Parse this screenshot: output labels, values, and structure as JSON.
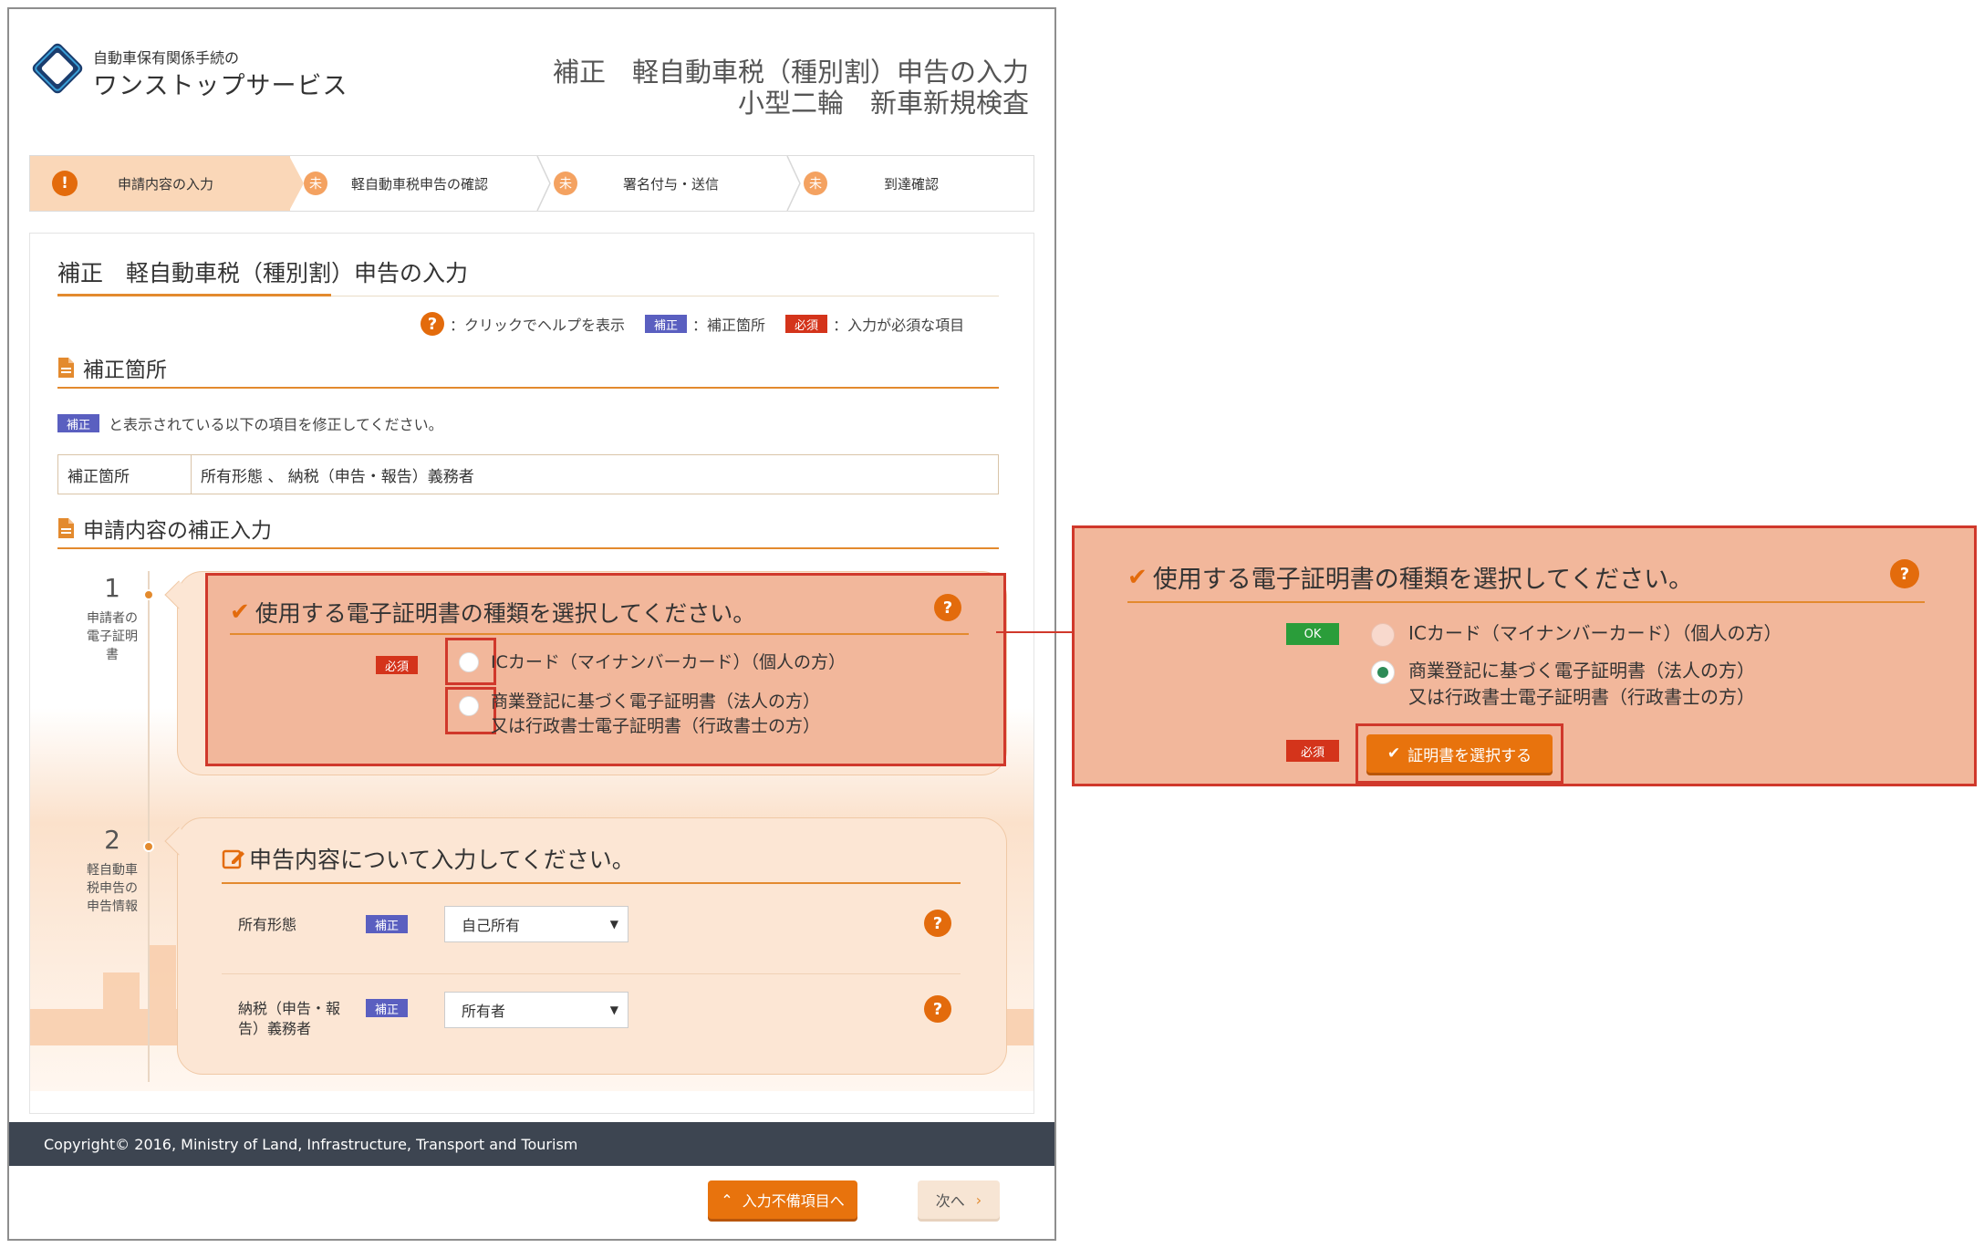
{
  "colors": {
    "accent": "#e8730d",
    "highlight": "#d0382b",
    "card_bg": "#fce6d4",
    "footer_bg": "#3d4551",
    "badge_fix": "#5a5fc0",
    "badge_required": "#d4341b",
    "badge_ok": "#2a9d3a"
  },
  "header": {
    "logo_small": "自動車保有関係手続の",
    "logo_big": "ワンストップサービス",
    "title_line1": "補正　軽自動車税（種別割）申告の入力",
    "title_line2": "小型二輪　新車新規検査"
  },
  "steps": [
    {
      "icon": "!",
      "label": "申請内容の入力"
    },
    {
      "icon": "未",
      "label": "軽自動車税申告の確認"
    },
    {
      "icon": "未",
      "label": "署名付与・送信"
    },
    {
      "icon": "未",
      "label": "到達確認"
    }
  ],
  "page": {
    "heading": "補正　軽自動車税（種別割）申告の入力",
    "legend": {
      "help_icon": "?",
      "help_text": "：クリックでヘルプを表示",
      "fix_badge": "補正",
      "fix_text": "：補正箇所",
      "required_badge": "必須",
      "required_text": "：入力が必須な項目"
    },
    "section1_title": "補正箇所",
    "notice_badge": "補正",
    "notice_text": "と表示されている以下の項目を修正してください。",
    "fix_key": "補正箇所",
    "fix_value": "所有形態 、 納税（申告・報告）義務者",
    "section2_title": "申請内容の補正入力"
  },
  "timeline": [
    {
      "number": "1",
      "label": "申請者の電子証明書"
    },
    {
      "number": "2",
      "label": "軽自動車税申告の申告情報"
    }
  ],
  "card1": {
    "title": "使用する電子証明書の種類を選択してください。",
    "required_badge": "必須",
    "option1": "ICカード（マイナンバーカード）（個人の方）",
    "option2_line1": "商業登記に基づく電子証明書（法人の方）",
    "option2_line2": "又は行政書士電子証明書（行政書士の方）"
  },
  "card2": {
    "title": "申告内容について入力してください。",
    "fields": [
      {
        "label": "所有形態",
        "badge": "補正",
        "value": "自己所有"
      },
      {
        "label": "納税（申告・報告）義務者",
        "badge": "補正",
        "value": "所有者"
      }
    ]
  },
  "footer": {
    "copyright": "Copyright© 2016, Ministry of Land, Infrastructure, Transport and Tourism",
    "prev_button": "入力不備項目へ",
    "next_button": "次へ"
  },
  "zoom": {
    "title": "使用する電子証明書の種類を選択してください。",
    "ok_badge": "OK",
    "option1": "ICカード（マイナンバーカード）（個人の方）",
    "option2_line1": "商業登記に基づく電子証明書（法人の方）",
    "option2_line2": "又は行政書士電子証明書（行政書士の方）",
    "option2_selected": true,
    "required_badge": "必須",
    "select_button": "証明書を選択する"
  }
}
